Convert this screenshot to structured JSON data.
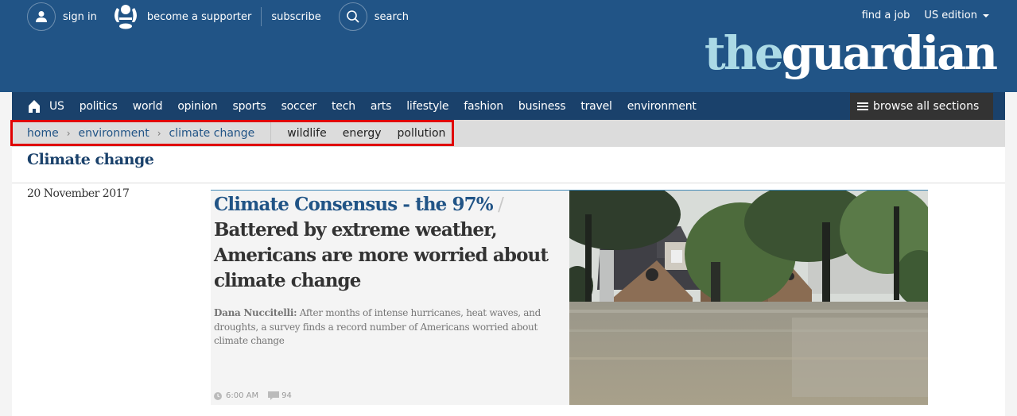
{
  "header": {
    "sign_in": "sign in",
    "become_supporter": "become a supporter",
    "subscribe": "subscribe",
    "search": "search",
    "find_job": "find a job",
    "edition": "US edition",
    "logo_the": "the",
    "logo_guardian": "guardian",
    "logo_colors": {
      "the": "#abdae6",
      "guardian": "#ffffff"
    },
    "background_color": "#215486"
  },
  "nav": {
    "home_icon": "home-icon",
    "items": [
      "US",
      "politics",
      "world",
      "opinion",
      "sports",
      "soccer",
      "tech",
      "arts",
      "lifestyle",
      "fashion",
      "business",
      "travel",
      "environment"
    ],
    "browse_label": "browse all sections"
  },
  "subnav": {
    "breadcrumbs": [
      "home",
      "environment",
      "climate change"
    ],
    "separator": "›",
    "links": [
      "wildlife",
      "energy",
      "pollution"
    ],
    "highlight_color": "#e00000"
  },
  "section": {
    "title": "Climate change",
    "date": "20 November 2017"
  },
  "article": {
    "kicker": "Climate Consensus - the 97%",
    "slash": " / ",
    "headline": "Battered by extreme weather, Americans are more worried about climate change",
    "byline": "Dana Nuccitelli:",
    "standfirst": " After months of intense hurricanes, heat waves, and droughts, a survey finds a record number of Americans worried about climate change",
    "time": "6:00 AM",
    "comments": "94",
    "image_alt": "Flooded houses surrounded by trees"
  }
}
